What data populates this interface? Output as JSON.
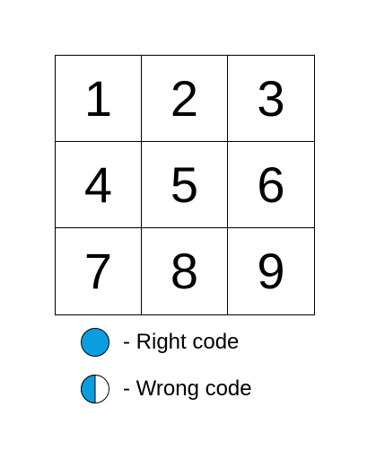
{
  "keypad": {
    "keys": [
      "1",
      "2",
      "3",
      "4",
      "5",
      "6",
      "7",
      "8",
      "9"
    ]
  },
  "legend": {
    "right": {
      "label": "- Right code",
      "icon": "filled-circle-icon",
      "color": "#0a9ee0"
    },
    "wrong": {
      "label": "- Wrong code",
      "icon": "half-filled-circle-icon",
      "color": "#0a9ee0"
    }
  }
}
